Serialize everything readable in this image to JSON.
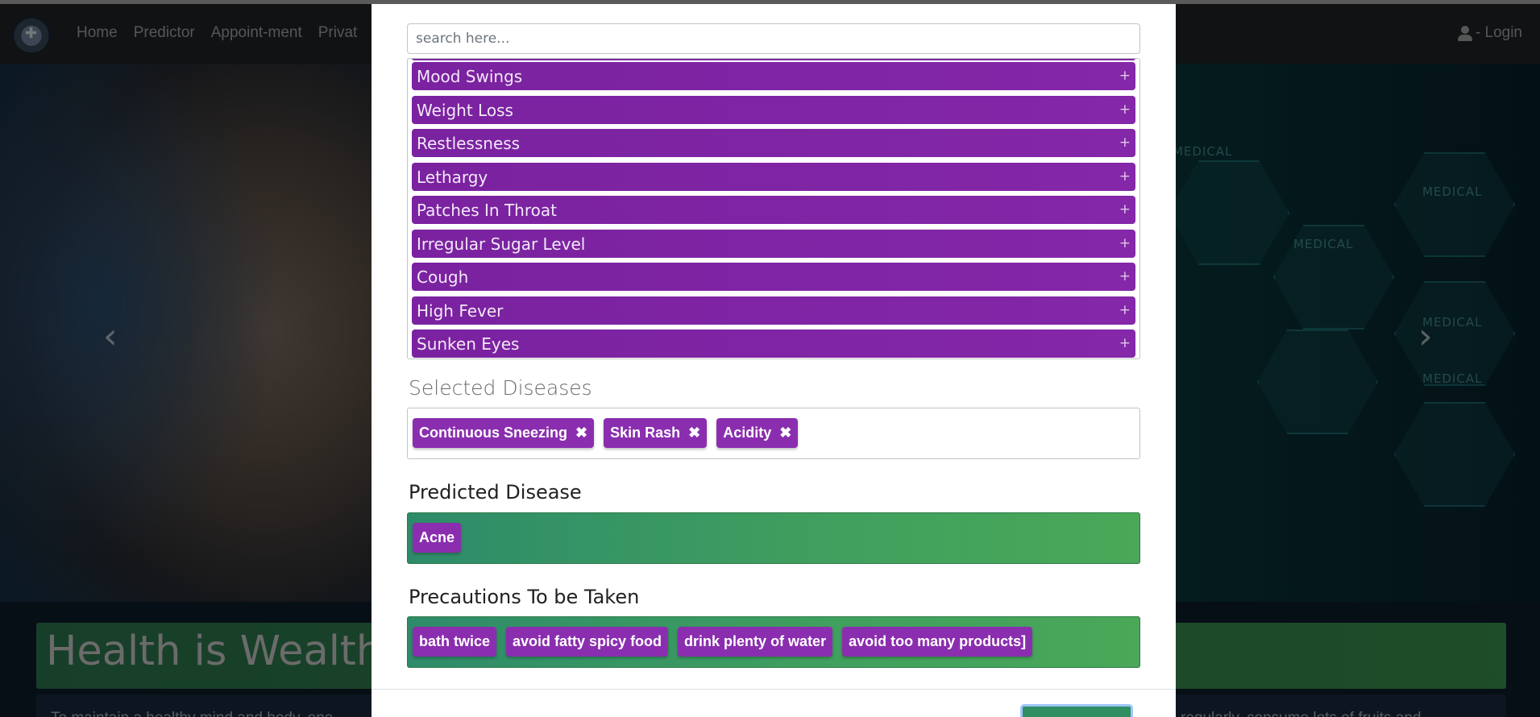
{
  "navbar": {
    "links": [
      "Home",
      "Predictor",
      "Appoint-ment",
      "Privat"
    ],
    "login_label": "- Login"
  },
  "hero": {
    "prev_arrow": "‹",
    "next_arrow": "›",
    "hex_labels": [
      "MEDICAL",
      "MEDICAL",
      "MEDICAL",
      "MEDICAL",
      "MEDICAL"
    ]
  },
  "banner": {
    "title": "Health is Wealth",
    "intro_left": "To maintain a healthy mind and body, one",
    "intro_right": "regularly, consume lots of fruits and"
  },
  "modal": {
    "search_placeholder": "search here...",
    "symptoms": [
      "Mood Swings",
      "Weight Loss",
      "Restlessness",
      "Lethargy",
      "Patches In Throat",
      "Irregular Sugar Level",
      "Cough",
      "High Fever",
      "Sunken Eyes"
    ],
    "add_glyph": "+",
    "selected_title": "Selected Diseases",
    "selected": [
      "Continuous Sneezing",
      "Skin Rash",
      "Acidity"
    ],
    "remove_glyph": "✖",
    "predicted_title": "Predicted Disease",
    "predicted": [
      "Acne"
    ],
    "precautions_title": "Precautions To be Taken",
    "precautions": [
      "bath twice",
      "avoid fatty spicy food",
      "drink plenty of water",
      "avoid too many products]"
    ]
  },
  "colors": {
    "symptom_bg": "#7f29a3",
    "chip_bg": "#8a2eaf",
    "result_green": "#3f9f5e",
    "navbar": "#212529"
  }
}
